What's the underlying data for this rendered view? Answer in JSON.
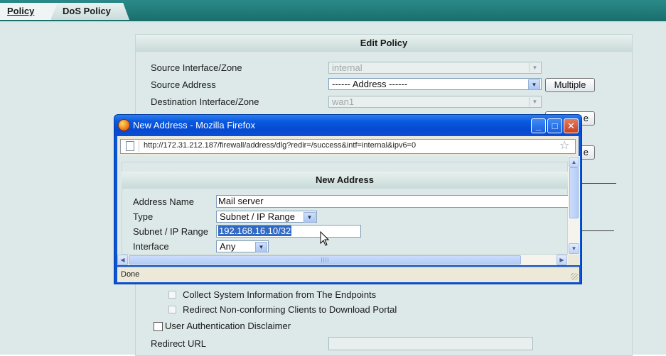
{
  "tabs": [
    {
      "label": "Policy",
      "active": true
    },
    {
      "label": "DoS Policy",
      "active": false
    }
  ],
  "edit_policy": {
    "title": "Edit Policy",
    "source_interface": {
      "label": "Source Interface/Zone",
      "value": "internal"
    },
    "source_address": {
      "label": "Source Address",
      "value": "------ Address ------",
      "button": "Multiple"
    },
    "destination_interface": {
      "label": "Destination Interface/Zone",
      "value": "wan1"
    },
    "hidden_button_fragment_1": "e",
    "hidden_button_fragment_2": "e",
    "collect_info_label": "Collect System Information from The Endpoints",
    "redirect_noncompliant_label": "Redirect Non-conforming Clients to Download Portal",
    "disclaimer_label": "User Authentication Disclaimer",
    "redirect_url_label": "Redirect URL",
    "redirect_url_value": ""
  },
  "popup": {
    "window_title": "New Address - Mozilla Firefox",
    "url": "http://172.31.212.187/firewall/address/dlg?redir=/success&intf=internal&ipv6=0",
    "status": "Done",
    "form": {
      "title": "New Address",
      "address_name": {
        "label": "Address Name",
        "value": "Mail server"
      },
      "type": {
        "label": "Type",
        "value": "Subnet / IP Range"
      },
      "subnet": {
        "label": "Subnet / IP Range",
        "value": "192.168.16.10/32"
      },
      "interface": {
        "label": "Interface",
        "value": "Any"
      }
    }
  },
  "icons": {
    "minimize": "_",
    "maximize": "□",
    "close": "✕",
    "dropdown": "▼",
    "star": "☆",
    "up": "▲",
    "down": "▼",
    "left": "◀",
    "right": "▶"
  },
  "colors": {
    "titlebar": "#0a5adf",
    "panel_bg": "#dce9e8",
    "header_teal": "#1a6e6c",
    "selection": "#316ac5"
  }
}
